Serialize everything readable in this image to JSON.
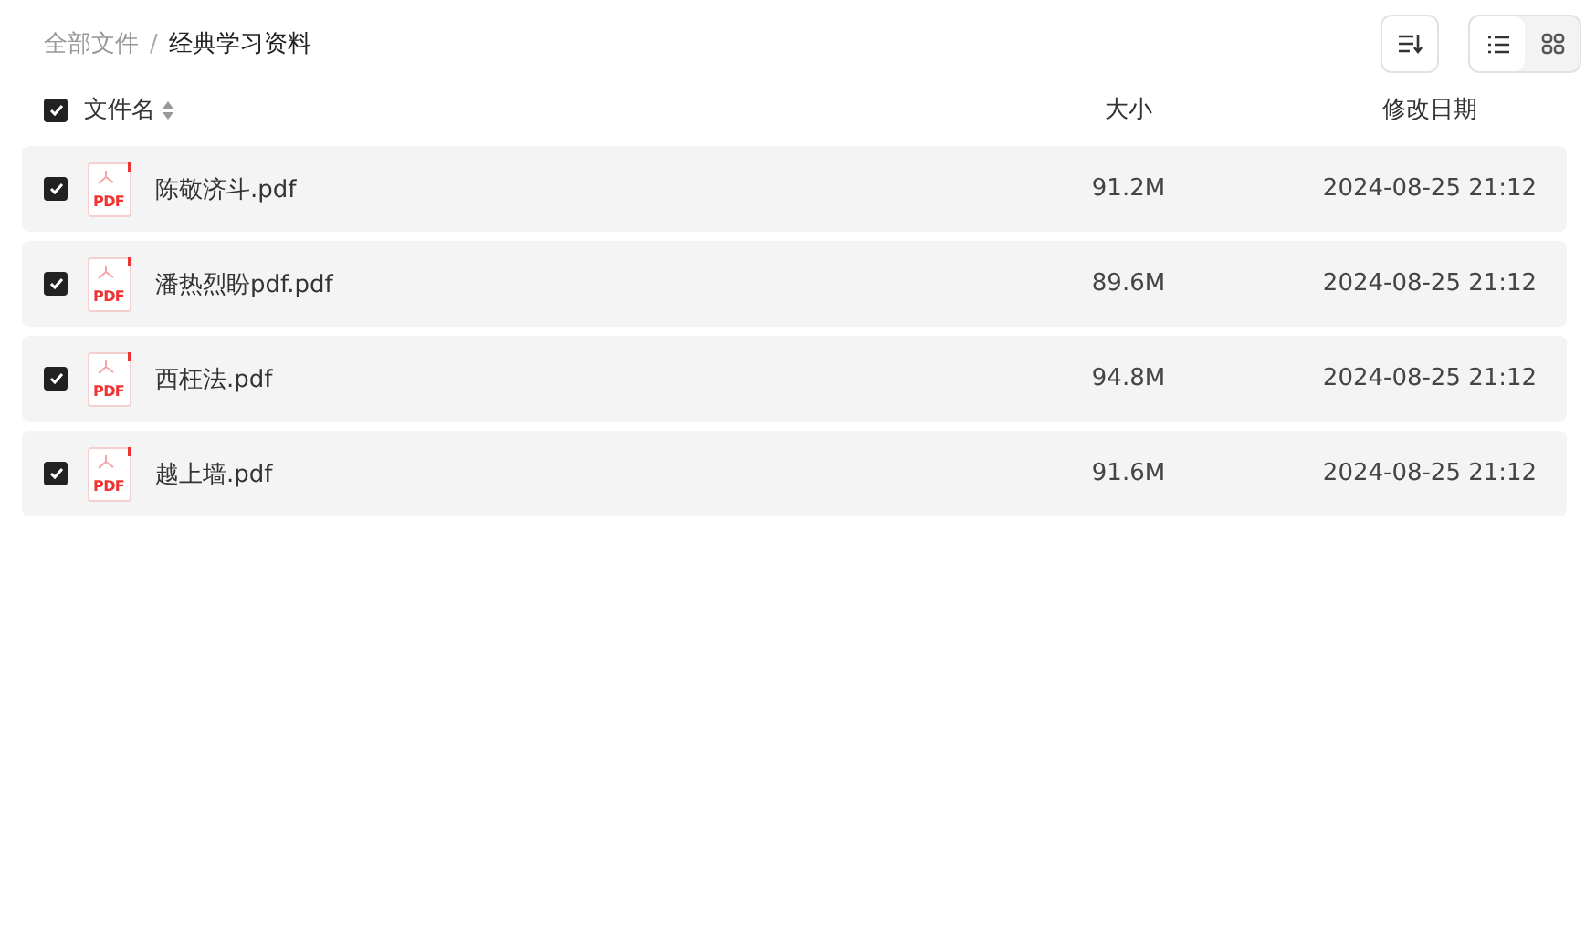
{
  "breadcrumb": [
    {
      "label": "全部文件",
      "current": false
    },
    {
      "label": "经典学习资料",
      "current": true
    }
  ],
  "breadcrumb_separator": "/",
  "view_toggle": [
    {
      "kind": "list",
      "selected": true
    },
    {
      "kind": "grid",
      "selected": false
    }
  ],
  "table": {
    "select_all_checked": true,
    "columns": [
      "文件名",
      "大小",
      "修改日期"
    ],
    "rows": [
      {
        "checked": true,
        "icon_label": "PDF",
        "name": "陈敬济斗.pdf",
        "size": "91.2M",
        "modified": "2024-08-25 21:12"
      },
      {
        "checked": true,
        "icon_label": "PDF",
        "name": "潘热烈盼pdf.pdf",
        "size": "89.6M",
        "modified": "2024-08-25 21:12"
      },
      {
        "checked": true,
        "icon_label": "PDF",
        "name": "西枉法.pdf",
        "size": "94.8M",
        "modified": "2024-08-25 21:12"
      },
      {
        "checked": true,
        "icon_label": "PDF",
        "name": "越上墙.pdf",
        "size": "91.6M",
        "modified": "2024-08-25 21:12"
      }
    ]
  }
}
